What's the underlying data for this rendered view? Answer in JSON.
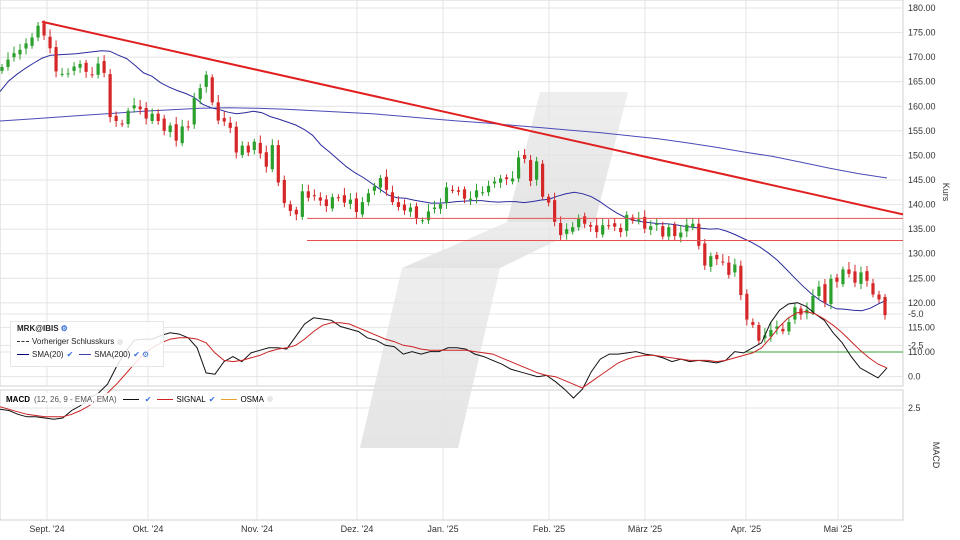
{
  "chart_data": [
    {
      "type": "candlestick",
      "symbol_label": "MRK@IBIS",
      "ylabel": "Kurs",
      "ylim": [
        100,
        181
      ],
      "y_ticks": [
        "110.00",
        "115.00",
        "120.00",
        "125.00",
        "130.00",
        "135.00",
        "140.00",
        "145.00",
        "150.00",
        "155.00",
        "160.00",
        "165.00",
        "170.00",
        "175.00",
        "180.00"
      ],
      "x_ticks": [
        "Sept. '24",
        "Okt. '24",
        "Nov. '24",
        "Dez. '24",
        "Jan. '25",
        "Feb. '25",
        "März '25",
        "Apr. '25",
        "Mai '25"
      ],
      "legend": {
        "symbol": "MRK@IBIS",
        "prev_close": "Vorheriger Schlusskurs",
        "sma20": "SMA(20)",
        "sma200": "SMA(200)"
      },
      "colors": {
        "up": "#2ca02c",
        "down": "#d62728",
        "sma20": "#2b2b9e",
        "sma200": "#4b4bb8",
        "trend": "#e02020",
        "support": "#e85050",
        "support_low": "#3aa03a"
      },
      "close": [
        168.0,
        169.5,
        170.8,
        171.5,
        172.8,
        174.0,
        176.4,
        174.4,
        171.8,
        167.1,
        166.6,
        166.7,
        168.1,
        168.6,
        167.0,
        166.4,
        168.7,
        166.8,
        157.8,
        157.0,
        156.4,
        159.1,
        160.2,
        159.4,
        157.5,
        158.5,
        157.0,
        155.0,
        156.1,
        153.0,
        155.9,
        155.8,
        161.7,
        163.7,
        166.4,
        160.8,
        157.1,
        156.9,
        155.6,
        150.6,
        152.0,
        150.6,
        152.8,
        150.4,
        147.7,
        152.1,
        144.5,
        140.3,
        138.7,
        138.0,
        142.7,
        141.4,
        141.7,
        140.8,
        139.7,
        141.5,
        141.4,
        140.4,
        141.0,
        138.5,
        140.5,
        142.3,
        143.7,
        145.4,
        143.0,
        140.5,
        139.5,
        138.8,
        139.4,
        137.2,
        136.8,
        138.6,
        139.4,
        140.1,
        143.5,
        142.9,
        142.6,
        141.2,
        141.2,
        142.9,
        142.5,
        143.8,
        144.7,
        145.3,
        145.2,
        145.3,
        149.6,
        149.3,
        144.8,
        148.8,
        141.6,
        140.4,
        136.5,
        133.8,
        135.0,
        135.4,
        137.1,
        136.1,
        135.5,
        134.4,
        135.8,
        135.7,
        135.5,
        134.4,
        137.9,
        136.7,
        137.0,
        135.1,
        135.6,
        136.1,
        133.5,
        135.4,
        133.6,
        134.3,
        135.9,
        136.1,
        131.6,
        127.6,
        129.5,
        128.9,
        128.2,
        125.7,
        127.8,
        121.6,
        116.6,
        115.5,
        112.3,
        113.4,
        114.5,
        115.2,
        114.2,
        116.1,
        119.1,
        117.6,
        118.6,
        121.4,
        123.3,
        120.0,
        124.9,
        124.3,
        126.8,
        125.9,
        124.1,
        126.2,
        124.5,
        121.7,
        120.7,
        117.5
      ],
      "sma20": [
        163.0,
        165.1,
        166.5,
        167.7,
        168.8,
        169.8,
        170.4,
        170.5,
        170.6,
        170.7,
        170.9,
        171.1,
        171.3,
        171.2,
        170.4,
        169.7,
        168.3,
        166.8,
        166.1,
        164.8,
        163.9,
        163.2,
        162.6,
        161.8,
        160.4,
        159.7,
        159.3,
        158.8,
        158.5,
        158.7,
        159.0,
        158.7,
        157.9,
        157.4,
        156.8,
        156.2,
        155.3,
        154.1,
        152.1,
        150.7,
        149.2,
        147.7,
        146.5,
        145.5,
        144.3,
        143.1,
        141.9,
        141.4,
        141.3,
        140.9,
        140.6,
        140.3,
        140.3,
        140.4,
        140.6,
        140.7,
        140.8,
        140.8,
        140.6,
        140.5,
        140.6,
        140.6,
        140.4,
        140.6,
        140.9,
        141.1,
        141.7,
        142.2,
        142.5,
        142.2,
        141.6,
        140.6,
        139.4,
        138.3,
        137.4,
        136.8,
        136.5,
        136.3,
        136.1,
        136.1,
        135.9,
        135.6,
        135.4,
        135.2,
        135.0,
        135.1,
        134.6,
        133.9,
        133.1,
        132.3,
        131.3,
        130.1,
        128.7,
        127.0,
        125.2,
        123.5,
        121.9,
        120.6,
        119.6,
        118.8,
        118.7,
        118.5,
        118.4,
        118.9,
        119.8,
        120.6
      ],
      "sma200": [
        157.0,
        157.4,
        157.8,
        158.2,
        158.6,
        159.0,
        159.3,
        159.6,
        159.7,
        159.6,
        159.4,
        159.1,
        158.8,
        158.5,
        158.0,
        157.5,
        157.0,
        156.6,
        156.1,
        155.6,
        155.1,
        154.6,
        154.0,
        153.4,
        152.6,
        151.7,
        150.7,
        149.8,
        148.6,
        147.4,
        146.3,
        145.4
      ],
      "trend_line": {
        "from": [
          "Sept. '24",
          177.2
        ],
        "to": [
          "Mai '25",
          138.0
        ]
      },
      "support_lines": [
        137.2,
        132.7,
        110.0
      ]
    },
    {
      "type": "line",
      "title": "MACD",
      "params": "(12, 26, 9 - EMA, EMA)",
      "ylabel": "MACD",
      "ylim": [
        -6.5,
        3.8
      ],
      "y_ticks": [
        "-5.0",
        "-2.5",
        "0.0",
        "2.5"
      ],
      "series": [
        {
          "name": "MACD",
          "color": "#111111",
          "values": [
            2.6,
            2.7,
            3.0,
            3.2,
            3.2,
            3.3,
            3.4,
            3.3,
            2.7,
            2.3,
            1.7,
            1.3,
            0.6,
            -0.8,
            -2.0,
            -2.9,
            -3.0,
            -3.0,
            -3.3,
            -3.5,
            -3.4,
            -3.1,
            -2.3,
            -0.3,
            -0.2,
            -1.2,
            -1.6,
            -1.2,
            -1.9,
            -2.1,
            -2.3,
            -2.3,
            -2.2,
            -3.2,
            -4.2,
            -4.7,
            -4.6,
            -4.5,
            -4.0,
            -3.8,
            -3.6,
            -3.1,
            -2.9,
            -2.5,
            -2.4,
            -1.8,
            -2.0,
            -1.8,
            -2.0,
            -2.0,
            -2.3,
            -2.3,
            -2.2,
            -1.8,
            -1.6,
            -1.3,
            -1.0,
            -0.6,
            -0.4,
            -0.2,
            0.0,
            -0.1,
            0.4,
            1.0,
            1.7,
            1.0,
            -0.4,
            -1.4,
            -1.8,
            -1.8,
            -1.9,
            -2.0,
            -1.8,
            -1.7,
            -1.5,
            -1.2,
            -1.4,
            -1.2,
            -1.3,
            -1.2,
            -1.1,
            -1.3,
            -2.0,
            -1.9,
            -2.3,
            -2.7,
            -4.3,
            -5.3,
            -5.8,
            -5.9,
            -5.6,
            -5.0,
            -4.5,
            -3.5,
            -2.7,
            -1.6,
            -0.7,
            -0.3,
            0.1,
            -0.7
          ]
        },
        {
          "name": "SIGNAL",
          "color": "#cc2222",
          "values": [
            2.4,
            2.6,
            2.8,
            3.0,
            3.1,
            3.2,
            3.2,
            3.2,
            3.0,
            2.7,
            2.3,
            1.8,
            1.3,
            0.6,
            -0.2,
            -1.0,
            -1.8,
            -2.3,
            -2.7,
            -3.0,
            -3.1,
            -3.1,
            -3.0,
            -2.7,
            -1.9,
            -1.3,
            -1.2,
            -1.3,
            -1.5,
            -1.7,
            -2.0,
            -2.2,
            -2.3,
            -2.5,
            -3.0,
            -3.6,
            -4.1,
            -4.3,
            -4.3,
            -4.2,
            -3.9,
            -3.6,
            -3.3,
            -3.0,
            -2.8,
            -2.5,
            -2.4,
            -2.2,
            -2.1,
            -2.1,
            -2.1,
            -2.1,
            -2.1,
            -2.0,
            -1.9,
            -1.8,
            -1.5,
            -1.2,
            -0.9,
            -0.6,
            -0.3,
            -0.1,
            0.0,
            0.3,
            0.6,
            0.9,
            0.4,
            -0.1,
            -0.6,
            -1.1,
            -1.4,
            -1.6,
            -1.7,
            -1.7,
            -1.6,
            -1.5,
            -1.4,
            -1.3,
            -1.3,
            -1.3,
            -1.2,
            -1.3,
            -1.5,
            -1.7,
            -1.9,
            -2.3,
            -3.1,
            -4.0,
            -4.7,
            -5.1,
            -5.2,
            -5.0,
            -4.6,
            -4.1,
            -3.5,
            -2.8,
            -2.1,
            -1.5,
            -1.0,
            -0.7
          ]
        }
      ],
      "legend": {
        "macd": "MACD",
        "signal": "SIGNAL",
        "osma": "OSMA"
      },
      "osma_color": "#e8a030"
    }
  ]
}
